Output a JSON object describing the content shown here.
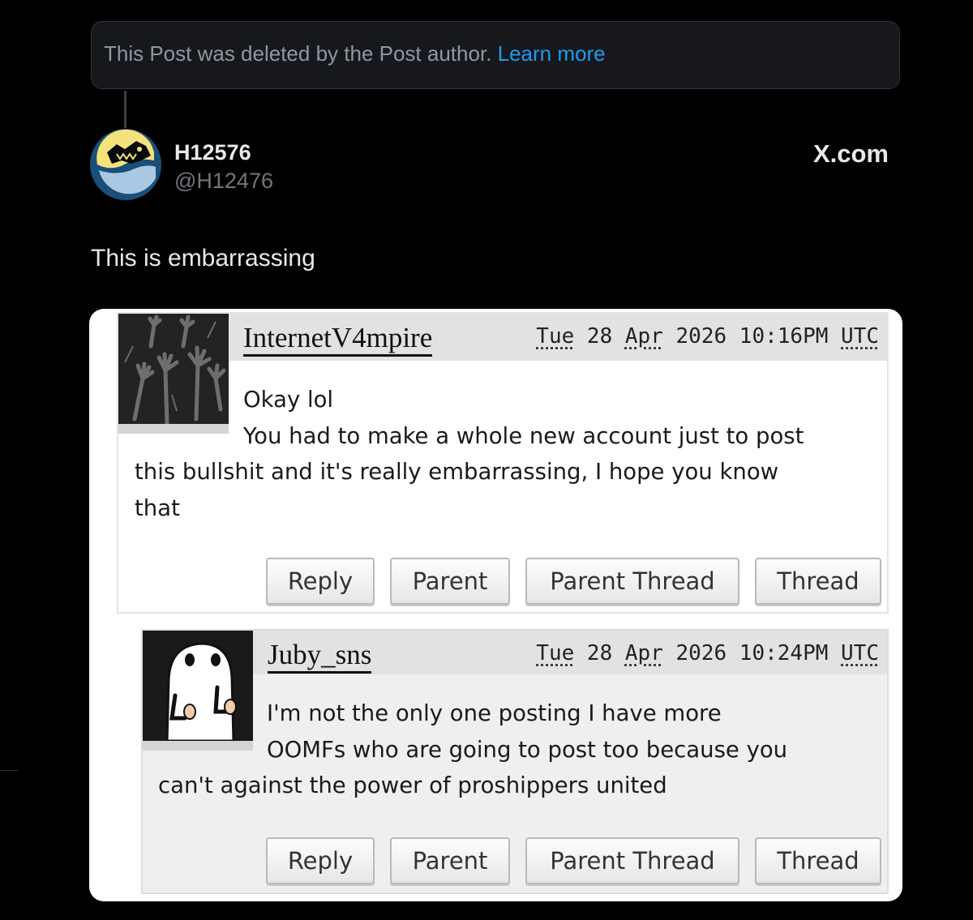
{
  "deleted_notice": {
    "text": "This Post was deleted by the Post author. ",
    "link": "Learn more"
  },
  "post": {
    "author_name": "H12576",
    "author_handle": "@H12476",
    "brand": "X.com",
    "text": "This is embarrassing"
  },
  "comments": [
    {
      "username": "InternetV4mpire",
      "date": {
        "dow": "Tue",
        "day": "28",
        "mon": "Apr",
        "year": "2026",
        "time": "10:16PM",
        "tz": "UTC"
      },
      "lines": [
        "Okay lol",
        "You had to make a whole new account just to post",
        "this bullshit and it's really embarrassing, I hope you know",
        "that"
      ],
      "buttons": [
        "Reply",
        "Parent",
        "Parent Thread",
        "Thread"
      ]
    },
    {
      "username": "Juby_sns",
      "date": {
        "dow": "Tue",
        "day": "28",
        "mon": "Apr",
        "year": "2026",
        "time": "10:24PM",
        "tz": "UTC"
      },
      "lines": [
        "I'm not the only one posting I have more",
        "OOMFs who are going to post too because you",
        "can't against the power of proshippers united"
      ],
      "buttons": [
        "Reply",
        "Parent",
        "Parent Thread",
        "Thread"
      ]
    }
  ]
}
